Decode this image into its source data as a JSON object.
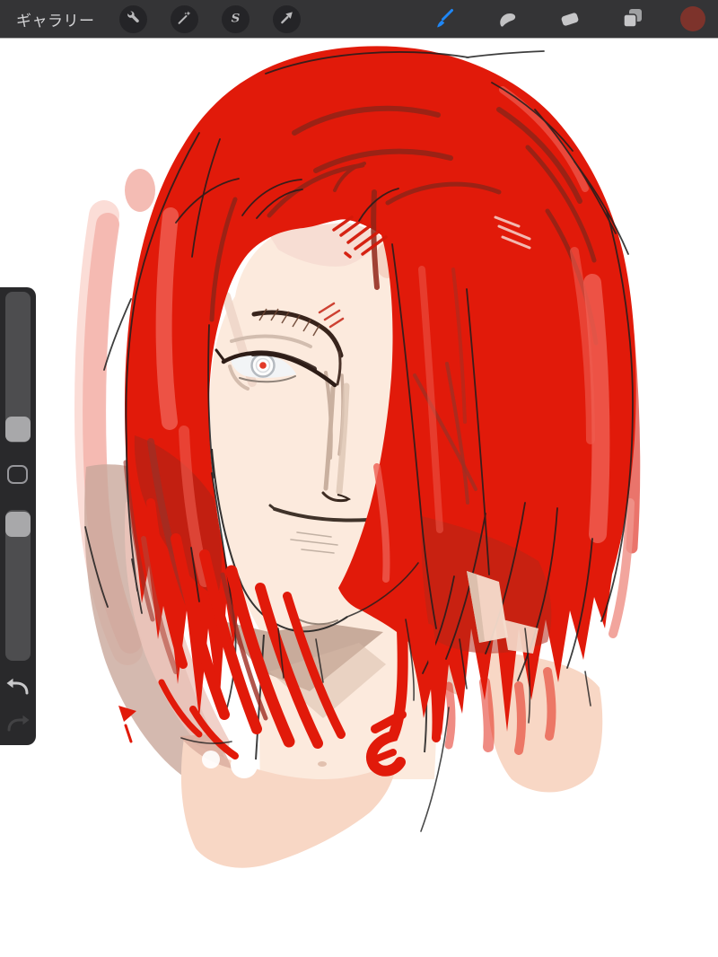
{
  "app": {
    "name": "procreate-canvas"
  },
  "toolbar": {
    "gallery_label": "ギャラリー",
    "left_tools": [
      {
        "name": "actions",
        "icon": "wrench-icon"
      },
      {
        "name": "adjustments",
        "icon": "magic-wand-icon"
      },
      {
        "name": "selections",
        "icon": "s-ribbon-icon"
      },
      {
        "name": "transform",
        "icon": "arrow-icon"
      }
    ],
    "right_tools": [
      {
        "name": "paint",
        "icon": "brush-icon",
        "active": true,
        "color": "#1f87f6"
      },
      {
        "name": "smudge",
        "icon": "smudge-icon"
      },
      {
        "name": "erase",
        "icon": "eraser-icon"
      },
      {
        "name": "layers",
        "icon": "layers-icon"
      },
      {
        "name": "color",
        "icon": "color-swatch",
        "color": "#7d332b"
      }
    ],
    "bar_color": "#343436",
    "icon_color": "#b9b9bb"
  },
  "sidebar": {
    "controls": [
      {
        "name": "brush-size-slider"
      },
      {
        "name": "modify-button"
      },
      {
        "name": "opacity-slider"
      },
      {
        "name": "undo",
        "icon": "undo-arrow-icon"
      },
      {
        "name": "redo",
        "icon": "redo-arrow-icon"
      }
    ],
    "undo_color": "#c9c9cb",
    "redo_color": "#424244"
  },
  "canvas": {
    "artwork": {
      "subject": "sketch portrait of a red-haired man, long bob, one visible eye, slight smile",
      "palette": {
        "main_red": "#e11a0a",
        "dark_red_sketch": "#9e2c20",
        "maroon_arc": "#8f2418",
        "highlight_red": "#ee5d50",
        "pale_pink": "#f4b6ae",
        "mauve_wash": "#c9a89b",
        "skin": "#fceadd",
        "skin_shadow": "#c5a897",
        "chest_wash": "#f8d7c5",
        "sketch_black": "#1d1d1d",
        "eye_white": "#f2f4f6",
        "pupil_red": "#e23a28",
        "brow_brown": "#38241c"
      }
    }
  }
}
